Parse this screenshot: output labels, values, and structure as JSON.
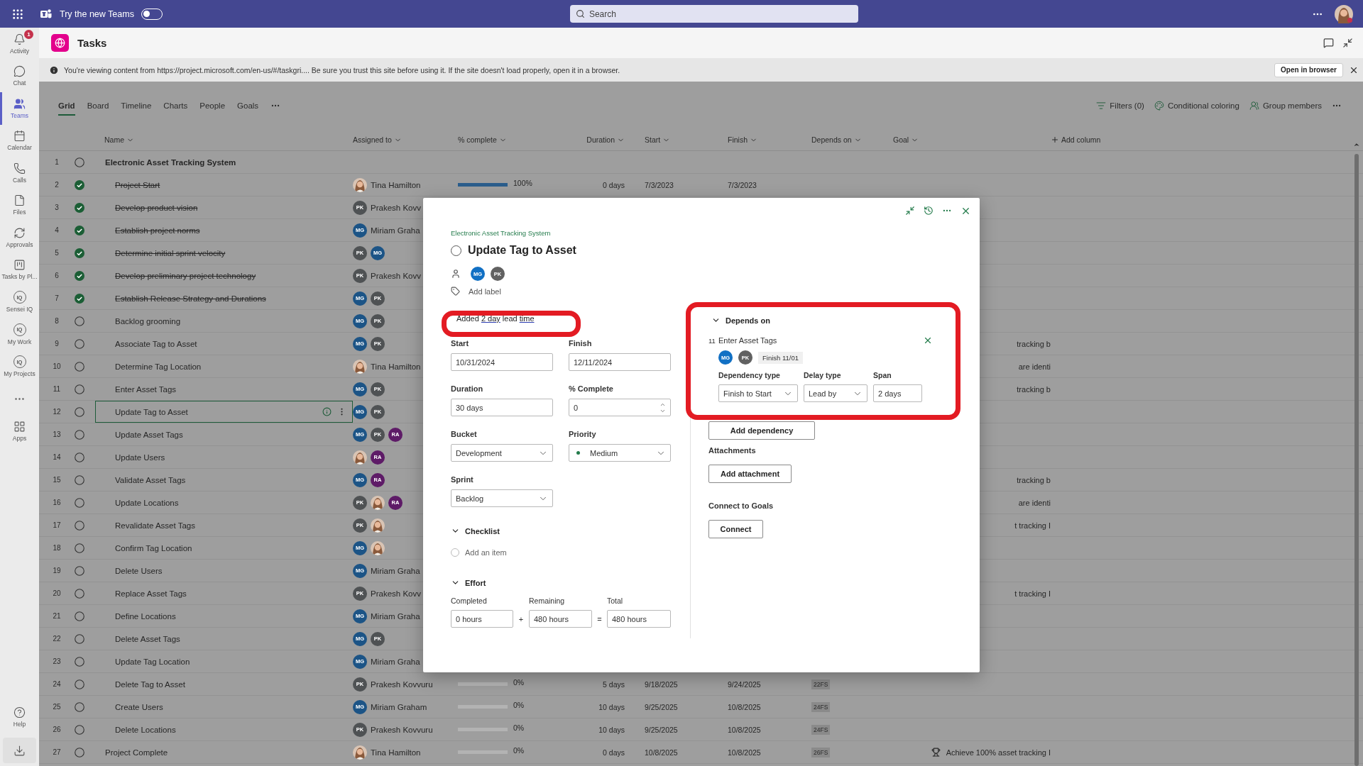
{
  "top_bar": {
    "toggle_label": "Try the new Teams",
    "toggle_on": false,
    "search": {
      "placeholder": "Search"
    }
  },
  "nav": [
    {
      "kind": "bell",
      "label": "Activity",
      "badge": "1",
      "selected": false
    },
    {
      "kind": "chat",
      "label": "Chat",
      "selected": false
    },
    {
      "kind": "teams",
      "label": "Teams",
      "selected": true
    },
    {
      "kind": "calendar",
      "label": "Calendar",
      "selected": false
    },
    {
      "kind": "calls",
      "label": "Calls",
      "selected": false
    },
    {
      "kind": "files",
      "label": "Files",
      "selected": false
    },
    {
      "kind": "approvals",
      "label": "Approvals",
      "selected": false
    },
    {
      "kind": "planner",
      "label": "Tasks by Pl...",
      "selected": false
    },
    {
      "kind": "iq",
      "icon_text": "IQ",
      "label": "Sensei IQ",
      "selected": false
    },
    {
      "kind": "iq",
      "icon_text": "IQ",
      "label": "My Work",
      "selected": false
    },
    {
      "kind": "iq",
      "icon_text": "IQ",
      "label": "My Projects",
      "selected": false
    },
    {
      "kind": "more",
      "selected": false
    },
    {
      "kind": "apps",
      "label": "Apps",
      "selected": false
    }
  ],
  "nav_bottom": {
    "help": "Help"
  },
  "app": {
    "title": "Tasks"
  },
  "banner": {
    "text": "You're viewing content from https://project.microsoft.com/en-us/#/taskgri.... Be sure you trust this site before using it. If the site doesn't load properly, open it in a browser.",
    "button": "Open in browser"
  },
  "tabs": [
    {
      "label": "Grid",
      "selected": true
    },
    {
      "label": "Board",
      "selected": false
    },
    {
      "label": "Timeline",
      "selected": false
    },
    {
      "label": "Charts",
      "selected": false
    },
    {
      "label": "People",
      "selected": false
    },
    {
      "label": "Goals",
      "selected": false
    }
  ],
  "toolbar": [
    {
      "kind": "filter",
      "label": "Filters (0)"
    },
    {
      "kind": "coloring",
      "label": "Conditional coloring"
    },
    {
      "kind": "group",
      "label": "Group members"
    }
  ],
  "columns": [
    "Name",
    "Assigned to",
    "% complete",
    "Duration",
    "Start",
    "Finish",
    "Depends on",
    "Goal"
  ],
  "add_column": "Add column",
  "rows": [
    {
      "number": "1",
      "name": "Electronic Asset Tracking System",
      "completed": false,
      "selected": false,
      "children": [
        {
          "number": "2",
          "name": "Project Start",
          "completed": true,
          "selected": false,
          "assignees": [
            {
              "kind": "photo"
            }
          ],
          "assignee_name": "Tina Hamilton",
          "percent": {
            "text": "100%",
            "level": 1
          },
          "duration": "0 days",
          "start": "7/3/2023",
          "finish": "7/3/2023"
        },
        {
          "number": "3",
          "name": "Develop product vision",
          "completed": true,
          "selected": false,
          "assignees": [
            {
              "kind": "initials",
              "initials": "PK",
              "color": "#4f5254"
            }
          ],
          "assignee_name": "Prakesh Kovv"
        },
        {
          "number": "4",
          "name": "Establish project norms",
          "completed": true,
          "selected": false,
          "assignees": [
            {
              "kind": "initials",
              "initials": "MG",
              "color": "#1c5486"
            }
          ],
          "assignee_name": "Miriam Graha"
        },
        {
          "number": "5",
          "name": "Determine initial sprint velocity",
          "completed": true,
          "selected": false,
          "assignees": [
            {
              "kind": "initials",
              "initials": "PK",
              "color": "#4f5254"
            },
            {
              "kind": "initials",
              "initials": "MG",
              "color": "#1c5486"
            }
          ]
        },
        {
          "number": "6",
          "name": "Develop preliminary project technology",
          "completed": true,
          "selected": false,
          "assignees": [
            {
              "kind": "initials",
              "initials": "PK",
              "color": "#4f5254"
            }
          ],
          "assignee_name": "Prakesh Kovv"
        },
        {
          "number": "7",
          "name": "Establish Release Strategy and Durations",
          "completed": true,
          "selected": false,
          "assignees": [
            {
              "kind": "initials",
              "initials": "MG",
              "color": "#1c5486"
            },
            {
              "kind": "initials",
              "initials": "PK",
              "color": "#4f5254"
            }
          ]
        },
        {
          "number": "8",
          "name": "Backlog grooming",
          "completed": false,
          "selected": false,
          "assignees": [
            {
              "kind": "initials",
              "initials": "MG",
              "color": "#1c5486"
            },
            {
              "kind": "initials",
              "initials": "PK",
              "color": "#4f5254"
            }
          ]
        },
        {
          "number": "9",
          "name": "Associate Tag to Asset",
          "completed": false,
          "selected": false,
          "assignees": [
            {
              "kind": "initials",
              "initials": "MG",
              "color": "#1c5486"
            },
            {
              "kind": "initials",
              "initials": "PK",
              "color": "#4f5254"
            }
          ],
          "goal": {
            "text": "tracking b",
            "trophy": false
          }
        },
        {
          "number": "10",
          "name": "Determine Tag Location",
          "completed": false,
          "selected": false,
          "assignees": [
            {
              "kind": "photo"
            }
          ],
          "assignee_name": "Tina Hamilton",
          "goal": {
            "text": "are identi",
            "trophy": false
          }
        },
        {
          "number": "11",
          "name": "Enter Asset Tags",
          "completed": false,
          "selected": false,
          "assignees": [
            {
              "kind": "initials",
              "initials": "MG",
              "color": "#1c5486"
            },
            {
              "kind": "initials",
              "initials": "PK",
              "color": "#4f5254"
            }
          ],
          "goal": {
            "text": "tracking b",
            "trophy": false
          }
        },
        {
          "number": "12",
          "name": "Update Tag to Asset",
          "completed": false,
          "selected": true,
          "assignees": [
            {
              "kind": "initials",
              "initials": "MG",
              "color": "#1c5486"
            },
            {
              "kind": "initials",
              "initials": "PK",
              "color": "#4f5254"
            }
          ]
        },
        {
          "number": "13",
          "name": "Update Asset Tags",
          "completed": false,
          "selected": false,
          "assignees": [
            {
              "kind": "initials",
              "initials": "MG",
              "color": "#1c5486"
            },
            {
              "kind": "initials",
              "initials": "PK",
              "color": "#4f5254"
            },
            {
              "kind": "initials",
              "initials": "RA",
              "color": "#5e1b67"
            }
          ]
        },
        {
          "number": "14",
          "name": "Update Users",
          "completed": false,
          "selected": false,
          "assignees": [
            {
              "kind": "photo"
            },
            {
              "kind": "initials",
              "initials": "RA",
              "color": "#5e1b67"
            }
          ]
        },
        {
          "number": "15",
          "name": "Validate Asset Tags",
          "completed": false,
          "selected": false,
          "assignees": [
            {
              "kind": "initials",
              "initials": "MG",
              "color": "#1c5486"
            },
            {
              "kind": "initials",
              "initials": "RA",
              "color": "#5e1b67"
            }
          ],
          "goal": {
            "text": "tracking b",
            "trophy": false
          }
        },
        {
          "number": "16",
          "name": "Update Locations",
          "completed": false,
          "selected": false,
          "assignees": [
            {
              "kind": "initials",
              "initials": "PK",
              "color": "#4f5254"
            },
            {
              "kind": "photo"
            },
            {
              "kind": "initials",
              "initials": "RA",
              "color": "#5e1b67"
            }
          ],
          "goal": {
            "text": "are identi",
            "trophy": false
          }
        },
        {
          "number": "17",
          "name": "Revalidate Asset Tags",
          "completed": false,
          "selected": false,
          "assignees": [
            {
              "kind": "initials",
              "initials": "PK",
              "color": "#4f5254"
            },
            {
              "kind": "photo"
            }
          ],
          "goal": {
            "text": "t tracking I",
            "trophy": false
          }
        },
        {
          "number": "18",
          "name": "Confirm Tag Location",
          "completed": false,
          "selected": false,
          "assignees": [
            {
              "kind": "initials",
              "initials": "MG",
              "color": "#1c5486"
            },
            {
              "kind": "photo"
            }
          ]
        },
        {
          "number": "19",
          "name": "Delete Users",
          "completed": false,
          "selected": false,
          "assignees": [
            {
              "kind": "initials",
              "initials": "MG",
              "color": "#1c5486"
            }
          ],
          "assignee_name": "Miriam Graha"
        },
        {
          "number": "20",
          "name": "Replace Asset Tags",
          "completed": false,
          "selected": false,
          "assignees": [
            {
              "kind": "initials",
              "initials": "PK",
              "color": "#4f5254"
            }
          ],
          "assignee_name": "Prakesh Kovv",
          "goal": {
            "text": "t tracking I",
            "trophy": false
          }
        },
        {
          "number": "21",
          "name": "Define Locations",
          "completed": false,
          "selected": false,
          "assignees": [
            {
              "kind": "initials",
              "initials": "MG",
              "color": "#1c5486"
            }
          ],
          "assignee_name": "Miriam Graha"
        },
        {
          "number": "22",
          "name": "Delete Asset Tags",
          "completed": false,
          "selected": false,
          "assignees": [
            {
              "kind": "initials",
              "initials": "MG",
              "color": "#1c5486"
            },
            {
              "kind": "initials",
              "initials": "PK",
              "color": "#4f5254"
            }
          ]
        },
        {
          "number": "23",
          "name": "Update Tag Location",
          "completed": false,
          "selected": false,
          "assignees": [
            {
              "kind": "initials",
              "initials": "MG",
              "color": "#1c5486"
            }
          ],
          "assignee_name": "Miriam Graha"
        },
        {
          "number": "24",
          "name": "Delete Tag to Asset",
          "completed": false,
          "selected": false,
          "assignees": [
            {
              "kind": "initials",
              "initials": "PK",
              "color": "#4f5254"
            }
          ],
          "assignee_name": "Prakesh Kovvuru",
          "percent": {
            "text": "0%",
            "level": 0
          },
          "duration": "5 days",
          "start": "9/18/2025",
          "finish": "9/24/2025",
          "depends": "22FS"
        },
        {
          "number": "25",
          "name": "Create Users",
          "completed": false,
          "selected": false,
          "assignees": [
            {
              "kind": "initials",
              "initials": "MG",
              "color": "#1c5486"
            }
          ],
          "assignee_name": "Miriam Graham",
          "percent": {
            "text": "0%",
            "level": 0
          },
          "duration": "10 days",
          "start": "9/25/2025",
          "finish": "10/8/2025",
          "depends": "24FS"
        },
        {
          "number": "26",
          "name": "Delete Locations",
          "completed": false,
          "selected": false,
          "assignees": [
            {
              "kind": "initials",
              "initials": "PK",
              "color": "#4f5254"
            }
          ],
          "assignee_name": "Prakesh Kovvuru",
          "percent": {
            "text": "0%",
            "level": 0
          },
          "duration": "10 days",
          "start": "9/25/2025",
          "finish": "10/8/2025",
          "depends": "24FS"
        }
      ]
    },
    {
      "number": "27",
      "name": "Project Complete",
      "completed": false,
      "selected": false,
      "assignees": [
        {
          "kind": "photo"
        }
      ],
      "assignee_name": "Tina Hamilton",
      "percent": {
        "text": "0%",
        "level": 0
      },
      "duration": "0 days",
      "start": "10/8/2025",
      "finish": "10/8/2025",
      "depends": "26FS",
      "goal": {
        "text": "Achieve 100% asset tracking I",
        "trophy": true
      }
    }
  ],
  "task": {
    "project": "Electronic Asset Tracking System",
    "title": "Update Tag to Asset",
    "completed": false,
    "assignees": [
      {
        "kind": "initials",
        "initials": "MG",
        "color": "#1170c4"
      },
      {
        "kind": "initials",
        "initials": "PK",
        "color": "#616161"
      }
    ],
    "add_label": "Add label",
    "note": [
      {
        "text": "Added ",
        "link": false
      },
      {
        "text": "2 day",
        "link": true
      },
      {
        "text": " lead ",
        "link": false
      },
      {
        "text": "time",
        "link": true
      }
    ],
    "fields": [
      {
        "kind": "text",
        "label": "Start",
        "value": "10/31/2024"
      },
      {
        "kind": "text",
        "label": "Finish",
        "value": "12/11/2024"
      },
      {
        "kind": "text",
        "label": "Duration",
        "value": "30 days"
      },
      {
        "kind": "spin",
        "label": "% Complete",
        "value": "0"
      },
      {
        "kind": "select",
        "label": "Bucket",
        "value": "Development"
      },
      {
        "kind": "priority",
        "label": "Priority",
        "value": "Medium",
        "color": "#237b4b"
      },
      {
        "kind": "select",
        "label": "Sprint",
        "value": "Backlog"
      }
    ],
    "checklist": {
      "title": "Checklist",
      "expanded": true,
      "placeholder": "Add an item"
    },
    "effort": {
      "title": "Effort",
      "expanded": true,
      "completed_label": "Completed",
      "completed": "0 hours",
      "plus": "+",
      "remaining_label": "Remaining",
      "remaining": "480 hours",
      "equals": "=",
      "total_label": "Total",
      "total": "480 hours"
    },
    "depends": {
      "title": "Depends on",
      "expanded": true,
      "item": {
        "number": "11",
        "name": "Enter Asset Tags",
        "assignees": [
          {
            "kind": "initials",
            "initials": "MG",
            "color": "#1170c4"
          },
          {
            "kind": "initials",
            "initials": "PK",
            "color": "#616161"
          }
        ],
        "finish": "Finish 11/01",
        "dependency_type_label": "Dependency type",
        "dependency_type": "Finish to Start",
        "delay_type_label": "Delay type",
        "delay_type": "Lead by",
        "span_label": "Span",
        "span": "2 days"
      },
      "add_button": "Add dependency"
    },
    "attachments": {
      "title": "Attachments",
      "button": "Add attachment"
    },
    "goals": {
      "title": "Connect to Goals",
      "button": "Connect"
    }
  }
}
